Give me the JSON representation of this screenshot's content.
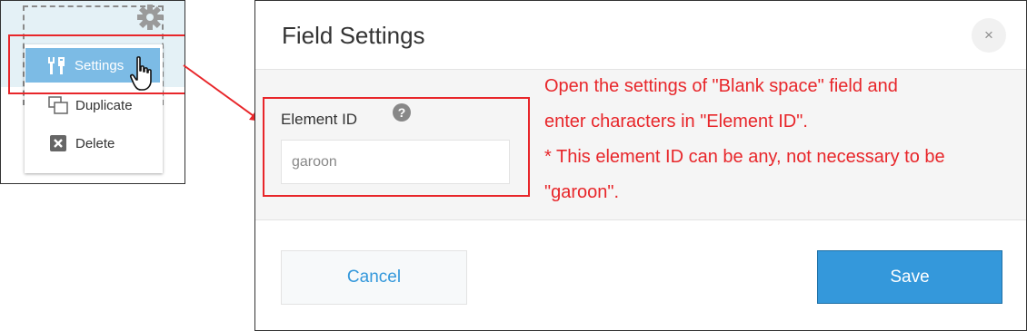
{
  "context_menu": {
    "items": [
      {
        "label": "Settings",
        "icon": "wrench-icon"
      },
      {
        "label": "Duplicate",
        "icon": "duplicate-icon"
      },
      {
        "label": "Delete",
        "icon": "delete-icon"
      }
    ],
    "colors": {
      "highlight": "#7cbbe5",
      "panel_bg": "#e4f1f6"
    }
  },
  "dialog": {
    "title": "Field Settings",
    "close_label": "×",
    "field": {
      "label": "Element ID",
      "value": "garoon"
    },
    "cancel_label": "Cancel",
    "save_label": "Save"
  },
  "annotation": {
    "lines": [
      "Open the settings of \"Blank space\" field and",
      "enter characters in \"Element ID\".",
      "* This element ID can be any, not necessary to be",
      "\"garoon\"."
    ],
    "color": "#e8262a"
  },
  "colors": {
    "accent": "#3498db",
    "annotation_red": "#e8262a"
  }
}
